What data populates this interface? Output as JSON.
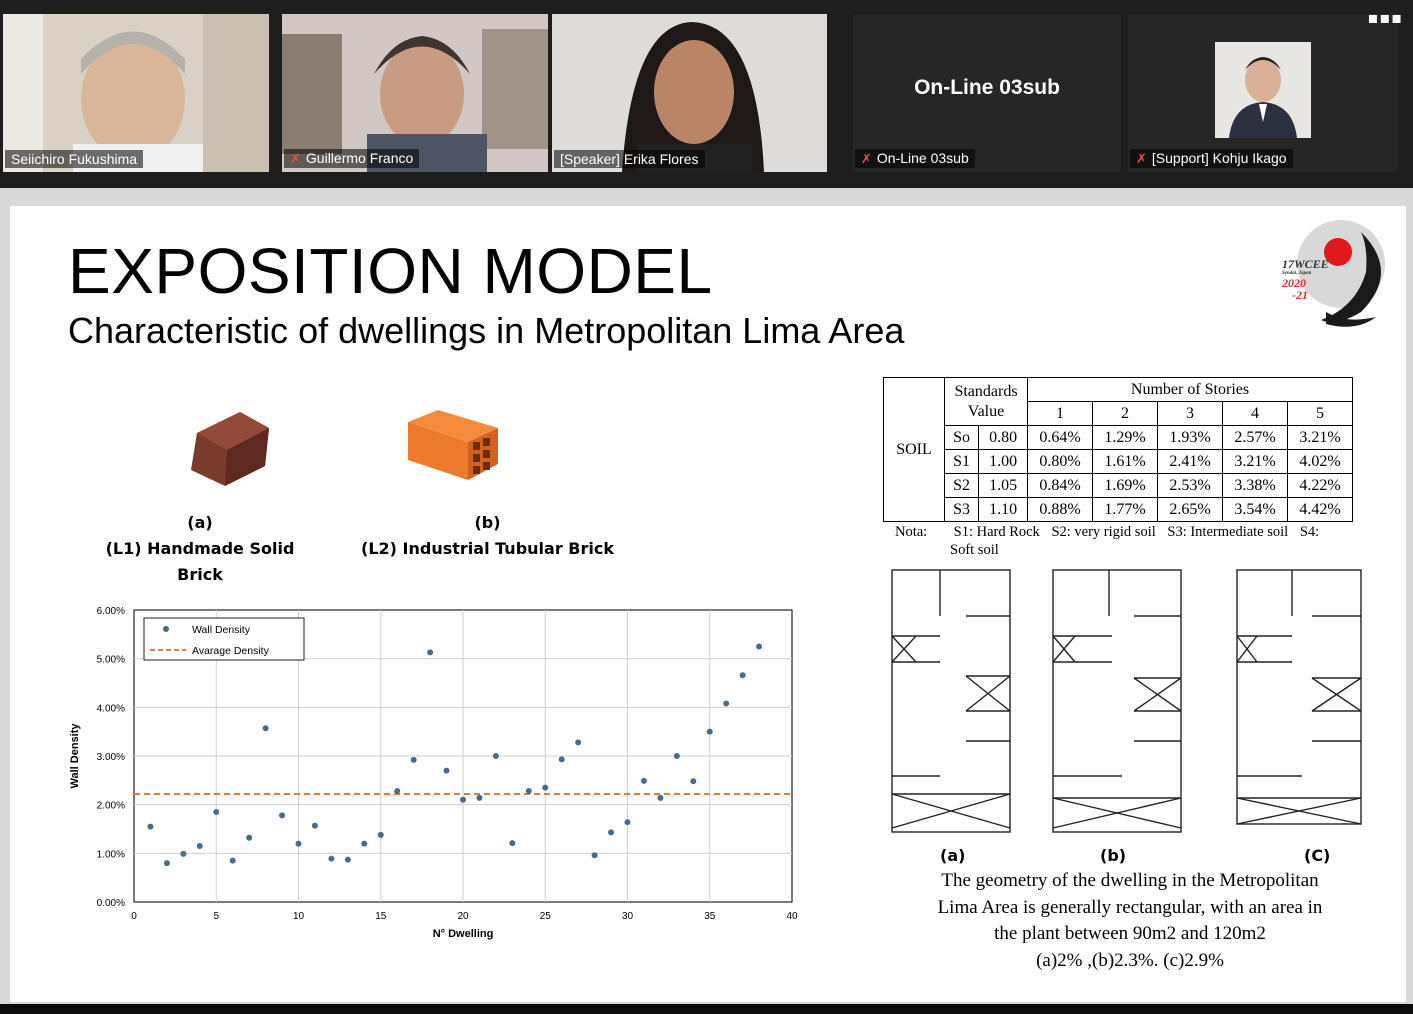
{
  "participants": [
    {
      "name": "Seiichiro Fukushima",
      "muted": false
    },
    {
      "name": "Guillermo Franco",
      "muted": true
    },
    {
      "name": "[Speaker] Erika Flores",
      "muted": false,
      "speaking": true
    },
    {
      "name": "On-Line 03sub",
      "muted": true,
      "big_label": "On-Line 03sub"
    },
    {
      "name": "[Support] Kohju Ikago",
      "muted": true
    }
  ],
  "slide": {
    "title": "EXPOSITION MODEL",
    "subtitle": "Characteristic of dwellings in Metropolitan Lima Area",
    "logo": {
      "line1": "17WCEE",
      "line2": "Sendai, Japan",
      "line3": "2020",
      "line4": "-21"
    },
    "bricks": [
      {
        "letter": "(a)",
        "label": "(L1) Handmade Solid Brick"
      },
      {
        "letter": "(b)",
        "label": "(L2) Industrial Tubular Brick"
      }
    ],
    "table": {
      "soil_label": "SOIL",
      "standards_header": "Standards Value",
      "stories_header": "Number of Stories",
      "stories": [
        "1",
        "2",
        "3",
        "4",
        "5"
      ],
      "rows": [
        {
          "soil": "So",
          "value": "0.80",
          "cells": [
            "0.64%",
            "1.29%",
            "1.93%",
            "2.57%",
            "3.21%"
          ]
        },
        {
          "soil": "S1",
          "value": "1.00",
          "cells": [
            "0.80%",
            "1.61%",
            "2.41%",
            "3.21%",
            "4.02%"
          ]
        },
        {
          "soil": "S2",
          "value": "1.05",
          "cells": [
            "0.84%",
            "1.69%",
            "2.53%",
            "3.38%",
            "4.22%"
          ]
        },
        {
          "soil": "S3",
          "value": "1.10",
          "cells": [
            "0.88%",
            "1.77%",
            "2.65%",
            "3.54%",
            "4.42%"
          ]
        }
      ]
    },
    "nota": {
      "label": "Nota:",
      "s1": "S1: Hard Rock",
      "s2": "S2: very rigid soil",
      "s3": "S3: Intermediate soil",
      "s4": "S4:",
      "s4b": "Soft soil"
    },
    "plan_labels": [
      "(a)",
      "(b)",
      "(C)"
    ],
    "description": [
      "The geometry of the dwelling in the Metropolitan",
      "Lima Area is generally rectangular, with an area in",
      "the plant between 90m2 and 120m2",
      "(a)2% ,(b)2.3%. (c)2.9%"
    ]
  },
  "chart_data": {
    "type": "scatter",
    "xlabel": "N° Dwelling",
    "ylabel": "Wall Density",
    "xlim": [
      0,
      40
    ],
    "ylim": [
      0,
      6
    ],
    "xticks": [
      "0",
      "5",
      "10",
      "15",
      "20",
      "25",
      "30",
      "35",
      "40"
    ],
    "yticks": [
      "0.00%",
      "1.00%",
      "2.00%",
      "3.00%",
      "4.00%",
      "5.00%",
      "6.00%"
    ],
    "grid": true,
    "legend_position": "top-left",
    "series": [
      {
        "name": "Wall Density",
        "color": "#4a6a8c",
        "x": [
          1,
          2,
          3,
          4,
          5,
          6,
          7,
          8,
          9,
          10,
          11,
          12,
          13,
          14,
          15,
          16,
          17,
          18,
          19,
          20,
          21,
          22,
          23,
          24,
          25,
          26,
          27,
          28,
          29,
          30,
          31,
          32,
          33,
          34,
          35,
          36,
          37,
          38
        ],
        "y": [
          1.55,
          0.8,
          0.99,
          1.15,
          1.85,
          0.85,
          1.32,
          3.57,
          1.78,
          1.2,
          1.57,
          0.89,
          0.87,
          1.2,
          1.38,
          2.28,
          2.92,
          5.13,
          2.7,
          2.1,
          2.14,
          3.0,
          1.21,
          2.28,
          2.35,
          2.93,
          3.28,
          0.96,
          1.43,
          1.64,
          2.49,
          2.14,
          3.0,
          2.48,
          3.5,
          4.08,
          4.66,
          5.25
        ]
      },
      {
        "name": "Avarage Density",
        "color": "#e07b39",
        "style": "dashed",
        "value": 2.22
      }
    ]
  }
}
